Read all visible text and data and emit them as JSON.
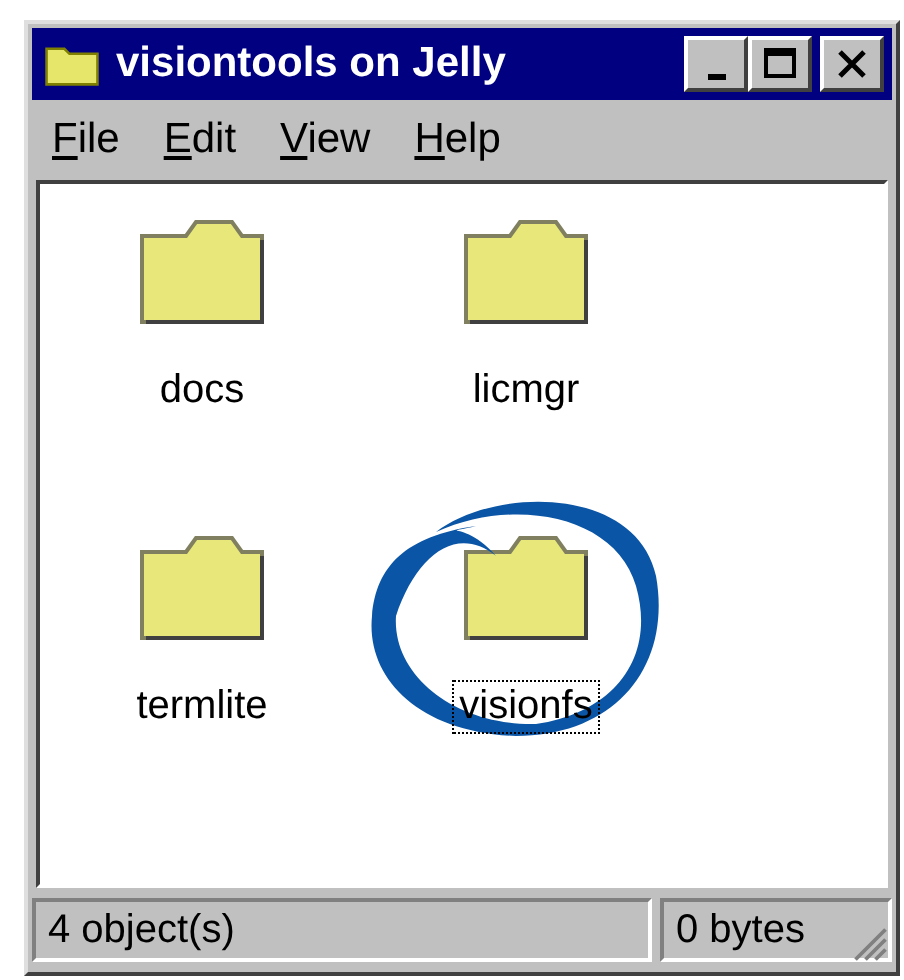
{
  "window": {
    "title": "visiontools on Jelly"
  },
  "menu": [
    {
      "label": "File"
    },
    {
      "label": "Edit"
    },
    {
      "label": "View"
    },
    {
      "label": "Help"
    }
  ],
  "items": [
    {
      "name": "docs",
      "selected": false
    },
    {
      "name": "licmgr",
      "selected": false
    },
    {
      "name": "termlite",
      "selected": false
    },
    {
      "name": "visionfs",
      "selected": true,
      "circled": true
    }
  ],
  "status_bar": {
    "count": "4 object(s)",
    "size": "0 bytes"
  }
}
